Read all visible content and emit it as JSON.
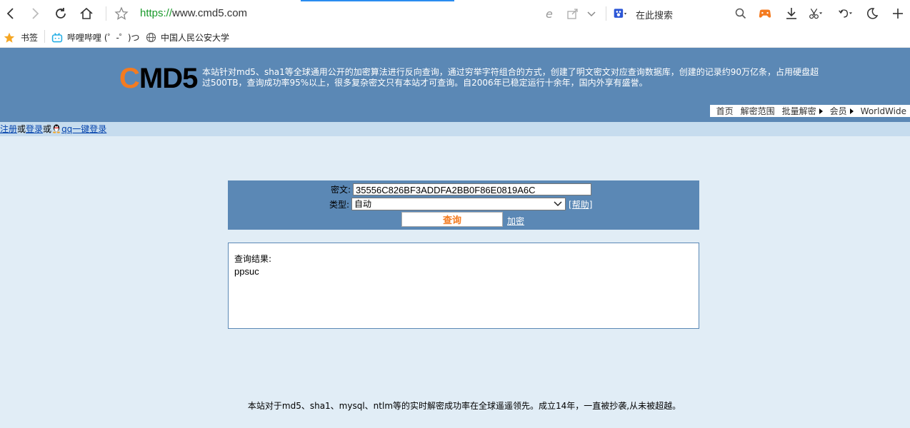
{
  "browser": {
    "url_scheme": "https://",
    "url_host": "www.cmd5.com",
    "search_placeholder": "在此搜索"
  },
  "bookmarks": [
    {
      "label": "书签",
      "icon": "star-icon"
    },
    {
      "label": "哔哩哔哩 (゜-゜)つ",
      "icon": "bilibili-icon"
    },
    {
      "label": "中国人民公安大学",
      "icon": "globe-icon"
    }
  ],
  "site": {
    "logo_c": "C",
    "logo_rest": "MD5",
    "description": "本站针对md5、sha1等全球通用公开的加密算法进行反向查询，通过穷举字符组合的方式，创建了明文密文对应查询数据库，创建的记录约90万亿条，占用硬盘超过500TB，查询成功率95%以上，很多复杂密文只有本站才可查询。自2006年已稳定运行十余年，国内外享有盛誉。",
    "nav": [
      {
        "label": "首页",
        "arrow": false
      },
      {
        "label": "解密范围",
        "arrow": false
      },
      {
        "label": "批量解密",
        "arrow": true
      },
      {
        "label": "会员",
        "arrow": true
      },
      {
        "label": "WorldWide",
        "arrow": false
      }
    ],
    "login": {
      "register": "注册",
      "or1": "或",
      "login": "登录",
      "or2": "或",
      "qq": "qq一键登录"
    }
  },
  "form": {
    "cipher_label": "密文:",
    "cipher_value": "35556C826BF3ADDFA2BB0F86E0819A6C",
    "type_label": "类型:",
    "type_value": "自动",
    "help_label": "[帮助]",
    "submit_label": "查询",
    "encrypt_label": "加密"
  },
  "result": {
    "title": "查询结果:",
    "value": "ppsuc"
  },
  "footer": "本站对于md5、sha1、mysql、ntlm等的实时解密成功率在全球遥遥领先。成立14年，一直被抄袭,从未被超越。",
  "colors": {
    "header_bg": "#5b88b5",
    "logo_accent": "#f47b20",
    "page_bg": "#e1edf6",
    "url_green": "#1a9a2b"
  }
}
